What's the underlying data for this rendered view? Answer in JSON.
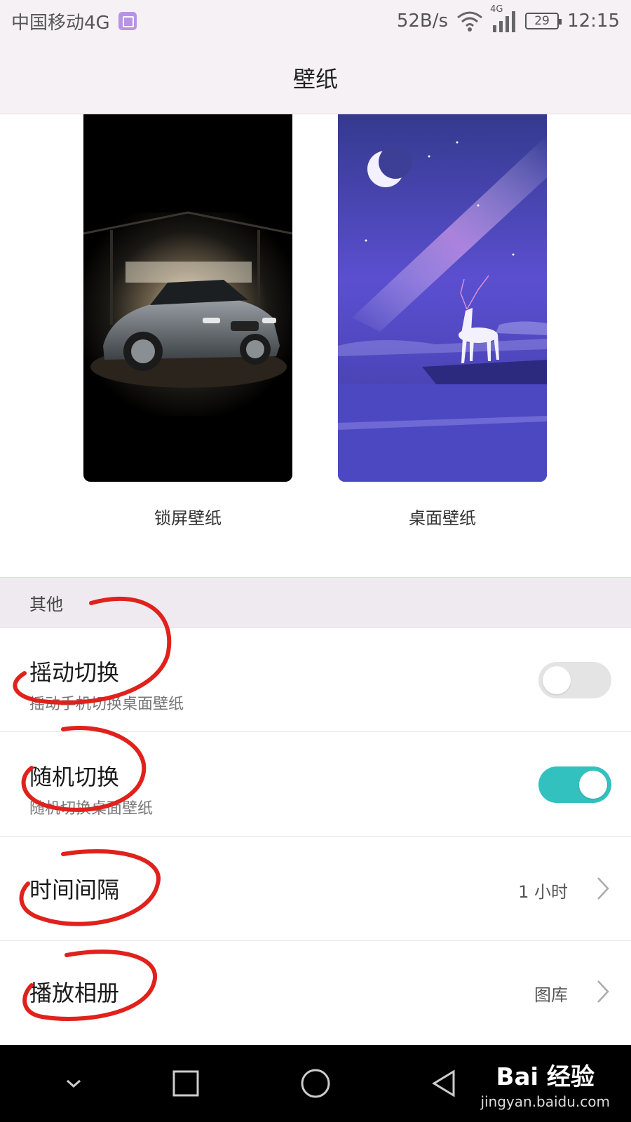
{
  "status_bar": {
    "carrier": "中国移动4G",
    "speed": "52B/s",
    "network_label": "4G",
    "battery": "29",
    "time": "12:15"
  },
  "header": {
    "title": "壁纸"
  },
  "wallpapers": {
    "lock_label": "锁屏壁纸",
    "home_label": "桌面壁纸"
  },
  "section": {
    "title": "其他"
  },
  "settings": {
    "shake": {
      "title": "摇动切换",
      "subtitle": "摇动手机切换桌面壁纸",
      "enabled": false
    },
    "random": {
      "title": "随机切换",
      "subtitle": "随机切换桌面壁纸",
      "enabled": true
    },
    "interval": {
      "title": "时间间隔",
      "value": "1 小时"
    },
    "album": {
      "title": "播放相册",
      "value": "图库"
    }
  },
  "watermark": {
    "logo": "Bai 经验",
    "url": "jingyan.baidu.com"
  },
  "colors": {
    "accent": "#33c1bf",
    "annotation": "#e0211c"
  }
}
